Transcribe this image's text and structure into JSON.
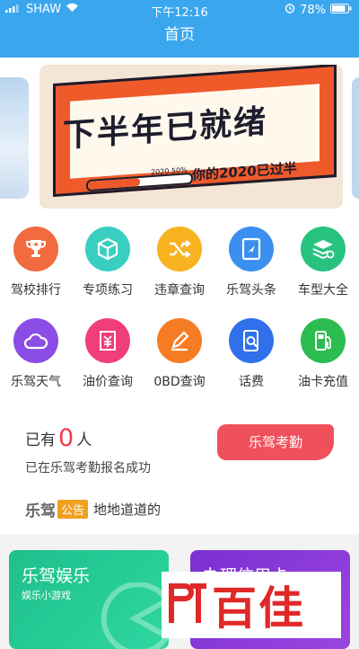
{
  "status": {
    "carrier": "SHAW",
    "time": "下午12:16",
    "battery": "78%"
  },
  "nav": {
    "title": "首页"
  },
  "banner": {
    "headline": "下半年已就绪",
    "subline": "你的2020已过半",
    "progress_label": "2020 50%",
    "progress": 0.5
  },
  "grid": {
    "row1": [
      {
        "label": "驾校排行",
        "icon": "trophy-icon",
        "color": "#f26a3f"
      },
      {
        "label": "专项练习",
        "icon": "cube-icon",
        "color": "#38cfc1"
      },
      {
        "label": "违章查询",
        "icon": "shuffle-icon",
        "color": "#f8b320"
      },
      {
        "label": "乐驾头条",
        "icon": "book-icon",
        "color": "#3a8ff0"
      },
      {
        "label": "车型大全",
        "icon": "layers-icon",
        "color": "#28c27f"
      }
    ],
    "row2": [
      {
        "label": "乐驾天气",
        "icon": "cloud-icon",
        "color": "#8b4de6"
      },
      {
        "label": "油价查询",
        "icon": "price-icon",
        "color": "#ef3e79"
      },
      {
        "label": "0BD查询",
        "icon": "pen-icon",
        "color": "#f57c23"
      },
      {
        "label": "话费",
        "icon": "phone-search-icon",
        "color": "#3070ea"
      },
      {
        "label": "油卡充值",
        "icon": "fuel-icon",
        "color": "#2cbc4f"
      }
    ]
  },
  "info": {
    "prefix": "已有",
    "count": "0",
    "suffix": "人",
    "signup_text": "已在乐驾考勤报名成功",
    "button_label": "乐驾考勤"
  },
  "news": {
    "brand": "乐驾",
    "tag": "公告",
    "text": "地地道道的"
  },
  "cards": {
    "green_title": "乐驾娱乐",
    "green_subtitle": "娱乐小游戏",
    "purple_title": "办理信用卡"
  },
  "watermark": {
    "text": "百佳"
  },
  "colors": {
    "primary": "#3aa6ee",
    "accent": "#f0505c",
    "count": "#ef3b4c"
  }
}
